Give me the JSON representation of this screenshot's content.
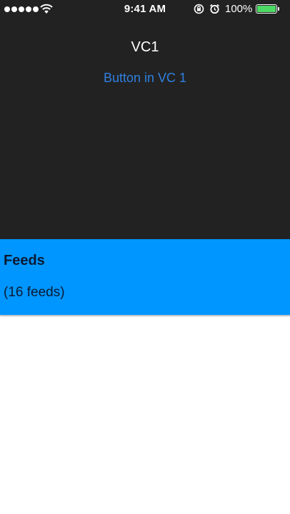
{
  "status_bar": {
    "time": "9:41 AM",
    "battery_percent": "100%",
    "battery_color": "#4cd964",
    "signal_bars": 5,
    "icons": [
      "signal-icon",
      "wifi-icon",
      "orientation-lock-icon",
      "alarm-icon",
      "battery-icon"
    ]
  },
  "top_view": {
    "title": "VC1",
    "button_label": "Button in VC 1",
    "background": "#222222",
    "button_color": "#2f80e0"
  },
  "feeds_panel": {
    "title": "Feeds",
    "count_text": "(16 feeds)",
    "background": "#0096ff"
  }
}
